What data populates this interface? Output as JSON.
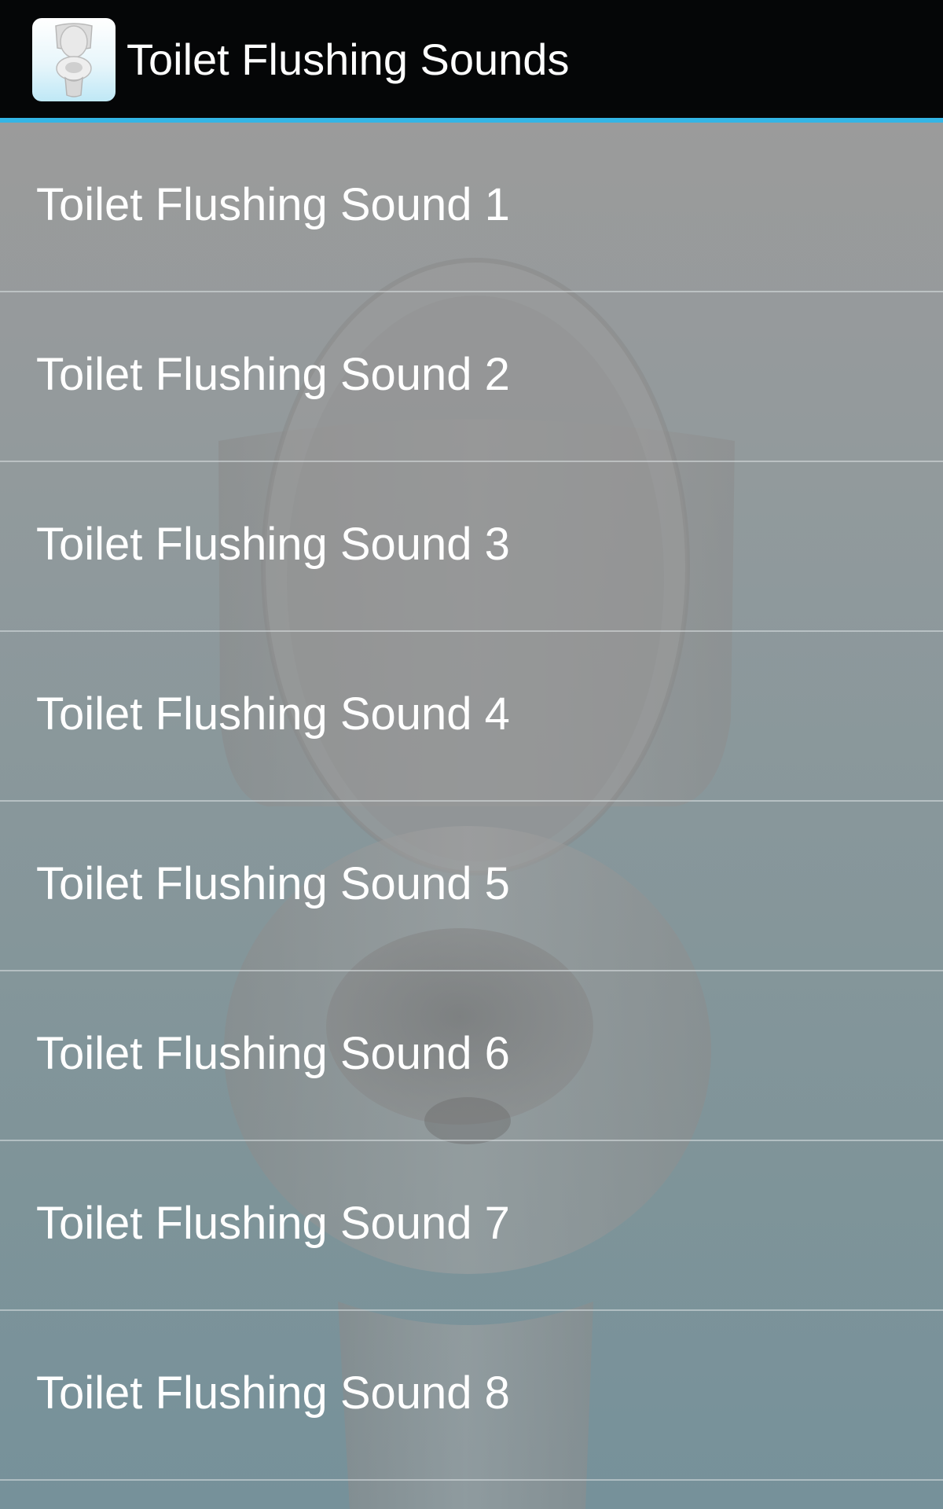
{
  "action_bar": {
    "app_icon": "toilet-icon",
    "title": "Toilet Flushing Sounds"
  },
  "background": {
    "image": "toilet-photo",
    "colors": [
      "#9b9b9b",
      "#76919a"
    ]
  },
  "list": {
    "items": [
      {
        "label": "Toilet Flushing Sound 1"
      },
      {
        "label": "Toilet Flushing Sound 2"
      },
      {
        "label": "Toilet Flushing Sound 3"
      },
      {
        "label": "Toilet Flushing Sound 4"
      },
      {
        "label": "Toilet Flushing Sound 5"
      },
      {
        "label": "Toilet Flushing Sound 6"
      },
      {
        "label": "Toilet Flushing Sound 7"
      },
      {
        "label": "Toilet Flushing Sound 8"
      }
    ]
  },
  "colors": {
    "action_bar_bg": "#050607",
    "accent": "#33b5e5",
    "text": "#ffffff"
  }
}
